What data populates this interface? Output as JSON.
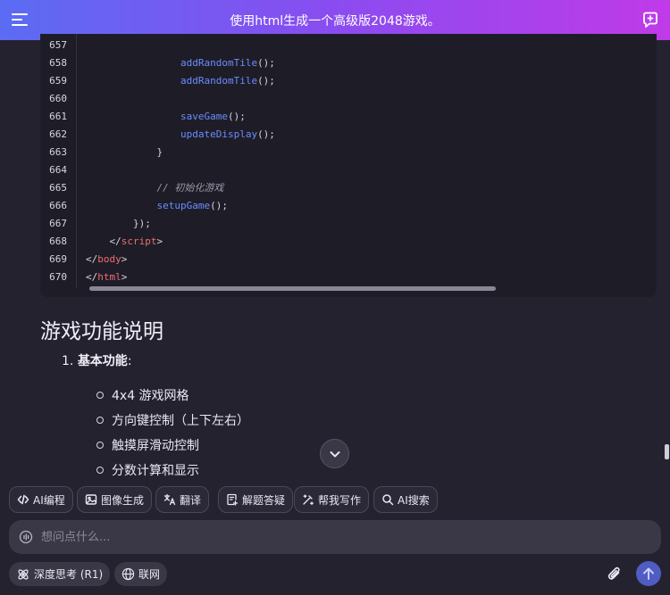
{
  "header": {
    "title": "使用html生成一个高级版2048游戏。"
  },
  "code": {
    "lines": [
      {
        "n": "657",
        "indent": 0,
        "tokens": []
      },
      {
        "n": "658",
        "indent": 16,
        "tokens": [
          {
            "t": "addRandomTile",
            "c": "fn"
          },
          {
            "t": "();",
            "c": "p"
          }
        ]
      },
      {
        "n": "659",
        "indent": 16,
        "tokens": [
          {
            "t": "addRandomTile",
            "c": "fn"
          },
          {
            "t": "();",
            "c": "p"
          }
        ]
      },
      {
        "n": "660",
        "indent": 0,
        "tokens": []
      },
      {
        "n": "661",
        "indent": 16,
        "tokens": [
          {
            "t": "saveGame",
            "c": "fn"
          },
          {
            "t": "();",
            "c": "p"
          }
        ]
      },
      {
        "n": "662",
        "indent": 16,
        "tokens": [
          {
            "t": "updateDisplay",
            "c": "fn"
          },
          {
            "t": "();",
            "c": "p"
          }
        ]
      },
      {
        "n": "663",
        "indent": 12,
        "tokens": [
          {
            "t": "}",
            "c": "p"
          }
        ]
      },
      {
        "n": "664",
        "indent": 0,
        "tokens": []
      },
      {
        "n": "665",
        "indent": 12,
        "tokens": [
          {
            "t": "// 初始化游戏",
            "c": "cmt"
          }
        ]
      },
      {
        "n": "666",
        "indent": 12,
        "tokens": [
          {
            "t": "setupGame",
            "c": "fn"
          },
          {
            "t": "();",
            "c": "p"
          }
        ]
      },
      {
        "n": "667",
        "indent": 8,
        "tokens": [
          {
            "t": "});",
            "c": "p"
          }
        ]
      },
      {
        "n": "668",
        "indent": 4,
        "tokens": [
          {
            "t": "</",
            "c": "p"
          },
          {
            "t": "script",
            "c": "tag"
          },
          {
            "t": ">",
            "c": "p"
          }
        ]
      },
      {
        "n": "669",
        "indent": 0,
        "tokens": [
          {
            "t": "</",
            "c": "p"
          },
          {
            "t": "body",
            "c": "tag"
          },
          {
            "t": ">",
            "c": "p"
          }
        ]
      },
      {
        "n": "670",
        "indent": 0,
        "tokens": [
          {
            "t": "</",
            "c": "p"
          },
          {
            "t": "html",
            "c": "tag"
          },
          {
            "t": ">",
            "c": "p"
          }
        ]
      }
    ]
  },
  "content": {
    "section_title": "游戏功能说明",
    "item_number": "1.",
    "item_title": "基本功能",
    "item_colon": ":",
    "bullets": [
      "4x4 游戏网格",
      "方向键控制（上下左右）",
      "触摸屏滑动控制",
      "分数计算和显示"
    ]
  },
  "tools": {
    "ai_code": "AI编程",
    "image_gen": "图像生成",
    "translate": "翻译",
    "solve": "解题答疑",
    "write": "帮我写作",
    "ai_search": "AI搜索"
  },
  "input": {
    "placeholder": "想问点什么..."
  },
  "bottom": {
    "deep_think": "深度思考 (R1)",
    "web": "联网"
  },
  "colors": {
    "header_gradient_start": "#5b6cf3",
    "header_gradient_end": "#c03ae8",
    "background": "#252230",
    "code_function": "#6b8cff",
    "code_tag": "#ef6b73",
    "send_button": "#4f5cc4"
  }
}
